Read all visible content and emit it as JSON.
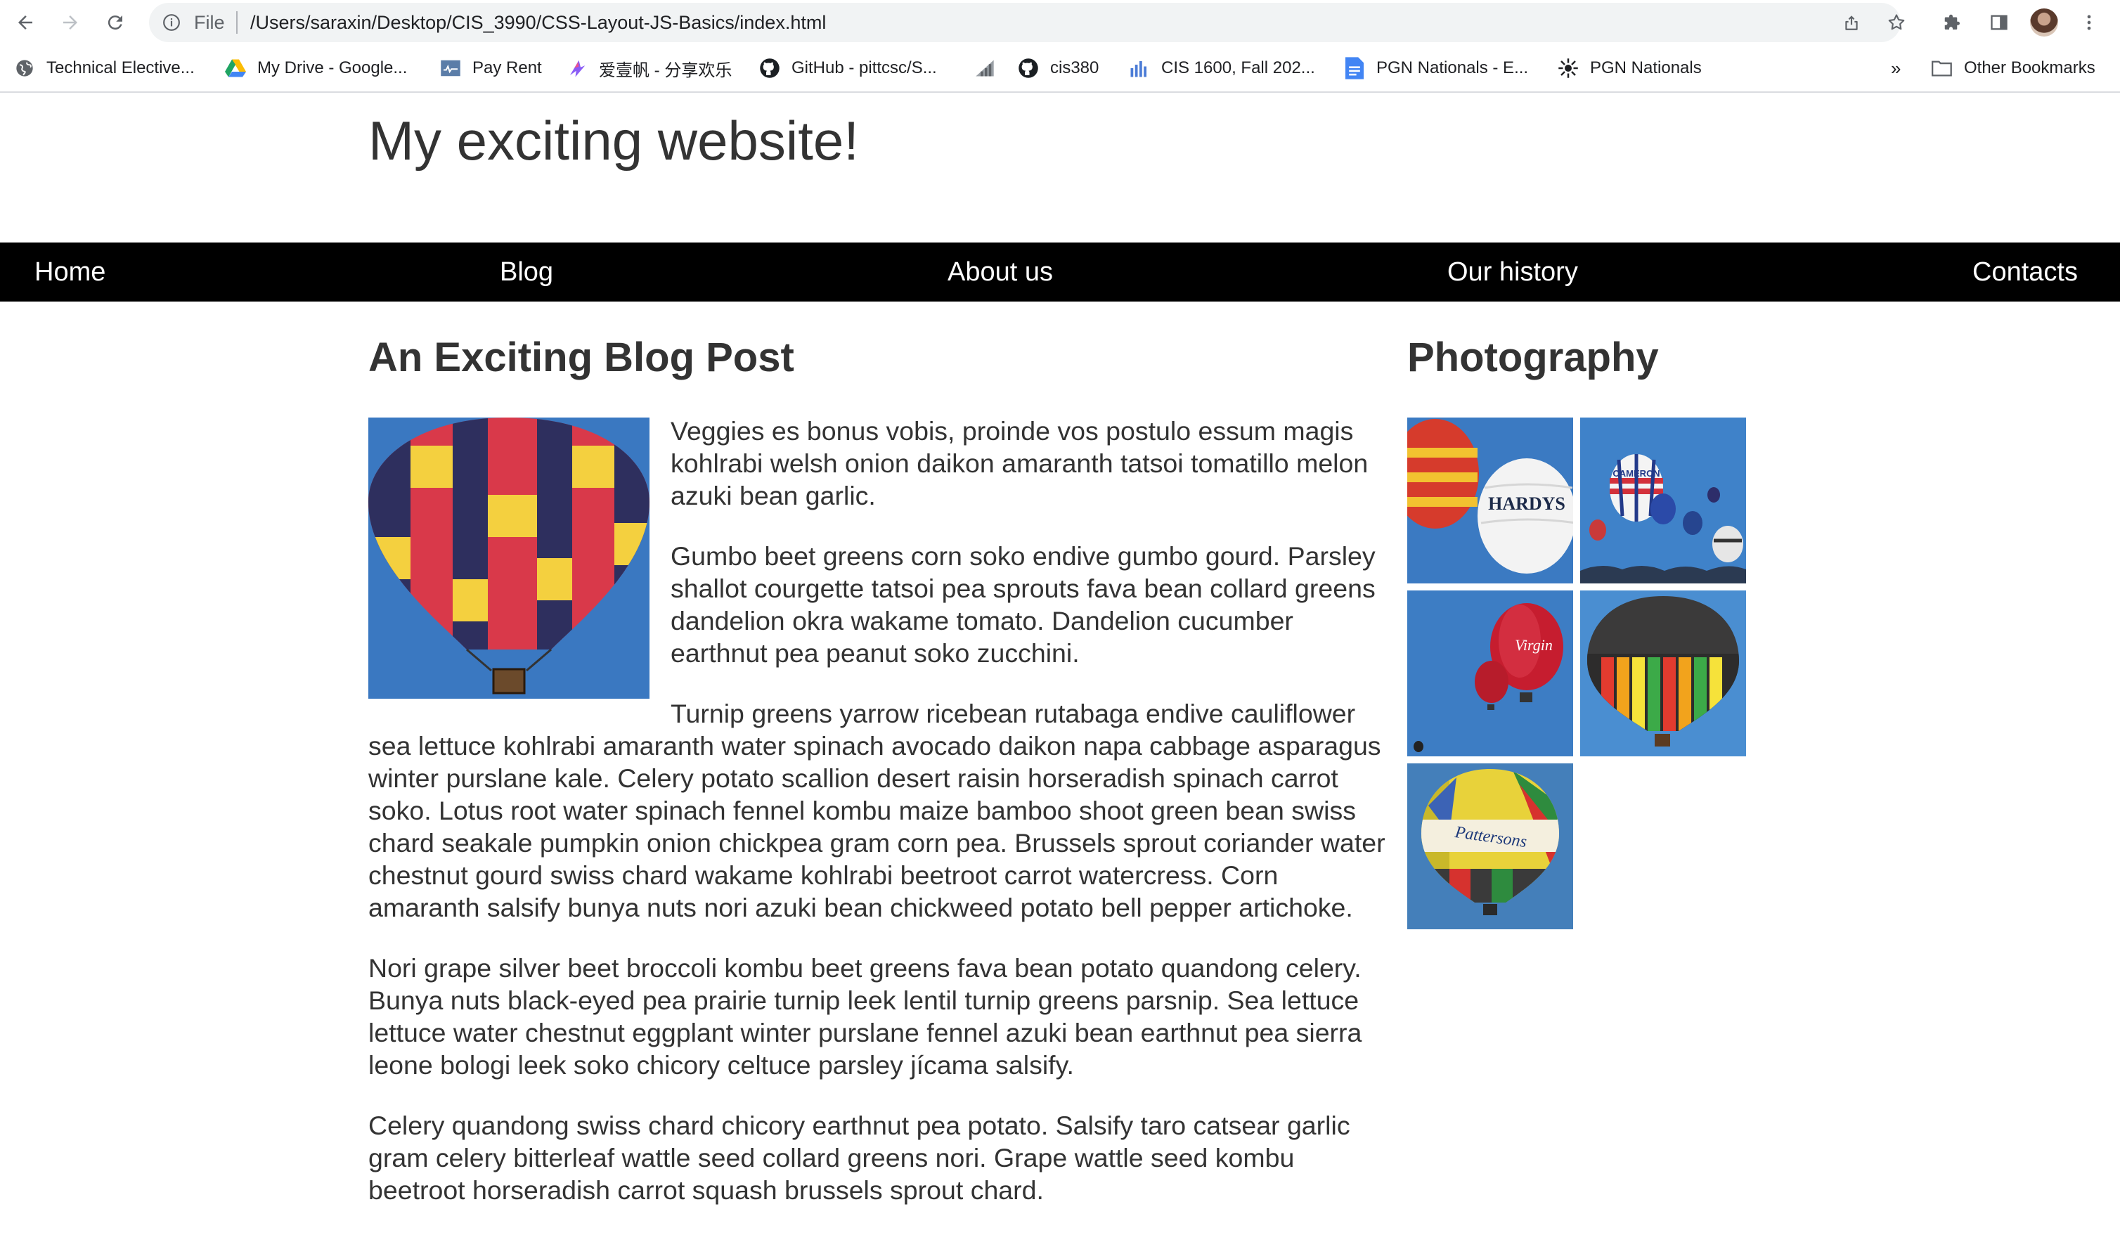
{
  "browser": {
    "scheme_label": "File",
    "url": "/Users/saraxin/Desktop/CIS_3990/CSS-Layout-JS-Basics/index.html",
    "bookmarks": [
      {
        "label": "Technical Elective...",
        "icon": "globe-icon"
      },
      {
        "label": "My Drive - Google...",
        "icon": "google-drive-icon"
      },
      {
        "label": "Pay Rent",
        "icon": "pay-rent-icon"
      },
      {
        "label": "爱壹帆 - 分享欢乐",
        "icon": "aiyifan-icon"
      },
      {
        "label": "GitHub - pittcsc/S...",
        "icon": "github-icon"
      },
      {
        "label": "",
        "icon": "signal-bars-icon"
      },
      {
        "label": "cis380",
        "icon": "github-icon"
      },
      {
        "label": "CIS 1600, Fall 202...",
        "icon": "bar-chart-icon"
      },
      {
        "label": "PGN Nationals - E...",
        "icon": "google-docs-icon"
      },
      {
        "label": "PGN Nationals",
        "icon": "starburst-icon"
      }
    ],
    "overflow_label": "»",
    "other_bookmarks_label": "Other Bookmarks"
  },
  "page": {
    "site_title": "My exciting website!",
    "nav": [
      "Home",
      "Blog",
      "About us",
      "Our history",
      "Contacts"
    ],
    "post": {
      "heading": "An Exciting Blog Post",
      "paragraphs": [
        "Veggies es bonus vobis, proinde vos postulo essum magis kohlrabi welsh onion daikon amaranth tatsoi tomatillo melon azuki bean garlic.",
        "Gumbo beet greens corn soko endive gumbo gourd. Parsley shallot courgette tatsoi pea sprouts fava bean collard greens dandelion okra wakame tomato. Dandelion cucumber earthnut pea peanut soko zucchini.",
        "Turnip greens yarrow ricebean rutabaga endive cauliflower sea lettuce kohlrabi amaranth water spinach avocado daikon napa cabbage asparagus winter purslane kale. Celery potato scallion desert raisin horseradish spinach carrot soko. Lotus root water spinach fennel kombu maize bamboo shoot green bean swiss chard seakale pumpkin onion chickpea gram corn pea. Brussels sprout coriander water chestnut gourd swiss chard wakame kohlrabi beetroot carrot watercress. Corn amaranth salsify bunya nuts nori azuki bean chickweed potato bell pepper artichoke.",
        "Nori grape silver beet broccoli kombu beet greens fava bean potato quandong celery. Bunya nuts black-eyed pea prairie turnip leek lentil turnip greens parsnip. Sea lettuce lettuce water chestnut eggplant winter purslane fennel azuki bean earthnut pea sierra leone bologi leek soko chicory celtuce parsley jícama salsify.",
        "Celery quandong swiss chard chicory earthnut pea potato. Salsify taro catsear garlic gram celery bitterleaf wattle seed collard greens nori. Grape wattle seed kombu beetroot horseradish carrot squash brussels sprout chard."
      ]
    },
    "photography": {
      "heading": "Photography",
      "photos": [
        {
          "caption": "HARDYS"
        },
        {
          "caption": "CAMERON"
        },
        {
          "caption": "Virgin"
        },
        {
          "caption": ""
        },
        {
          "caption": "Pattersons"
        }
      ]
    }
  }
}
